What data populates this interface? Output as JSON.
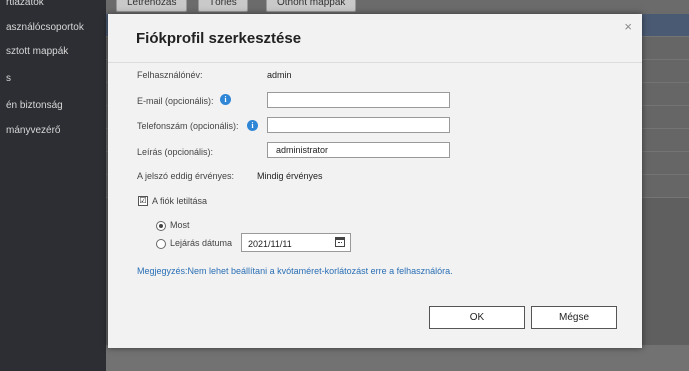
{
  "background": {
    "sidebar_items": [
      "rtiazatok",
      "asználócsoportok",
      "sztott mappák",
      "s",
      "én biztonság",
      "mányvezérő"
    ],
    "toolbar_buttons": [
      "Létrehozás",
      "Törlés",
      "Othont mappák"
    ]
  },
  "dialog": {
    "title": "Fiókprofil szerkesztése",
    "close_symbol": "×",
    "username_label": "Felhasználónév:",
    "username_value": "admin",
    "email_label": "E-mail (opcionális):",
    "email_value": "",
    "phone_label": "Telefonszám (opcionális):",
    "phone_value": "",
    "description_label": "Leírás (opcionális):",
    "description_value": "administrator",
    "password_expiry_label": "A jelszó eddig érvényes:",
    "password_expiry_value": "Mindig érvényes",
    "disable_account_label": "A fiók letiltása",
    "disable_account_checked": "☑",
    "now_label": "Most",
    "expiry_date_label": "Lejárás dátuma",
    "expiry_date_value": "2021/11/11",
    "note": "Megjegyzés:Nem lehet beállítani a kvótaméret-korlátozást erre a felhasználóra.",
    "ok_button": "OK",
    "cancel_button": "Mégse",
    "info_glyph": "i"
  },
  "colors": {
    "accent_blue": "#2f86d6",
    "note_text": "#2a6fb5",
    "dialog_bg": "#f2f2f2"
  }
}
